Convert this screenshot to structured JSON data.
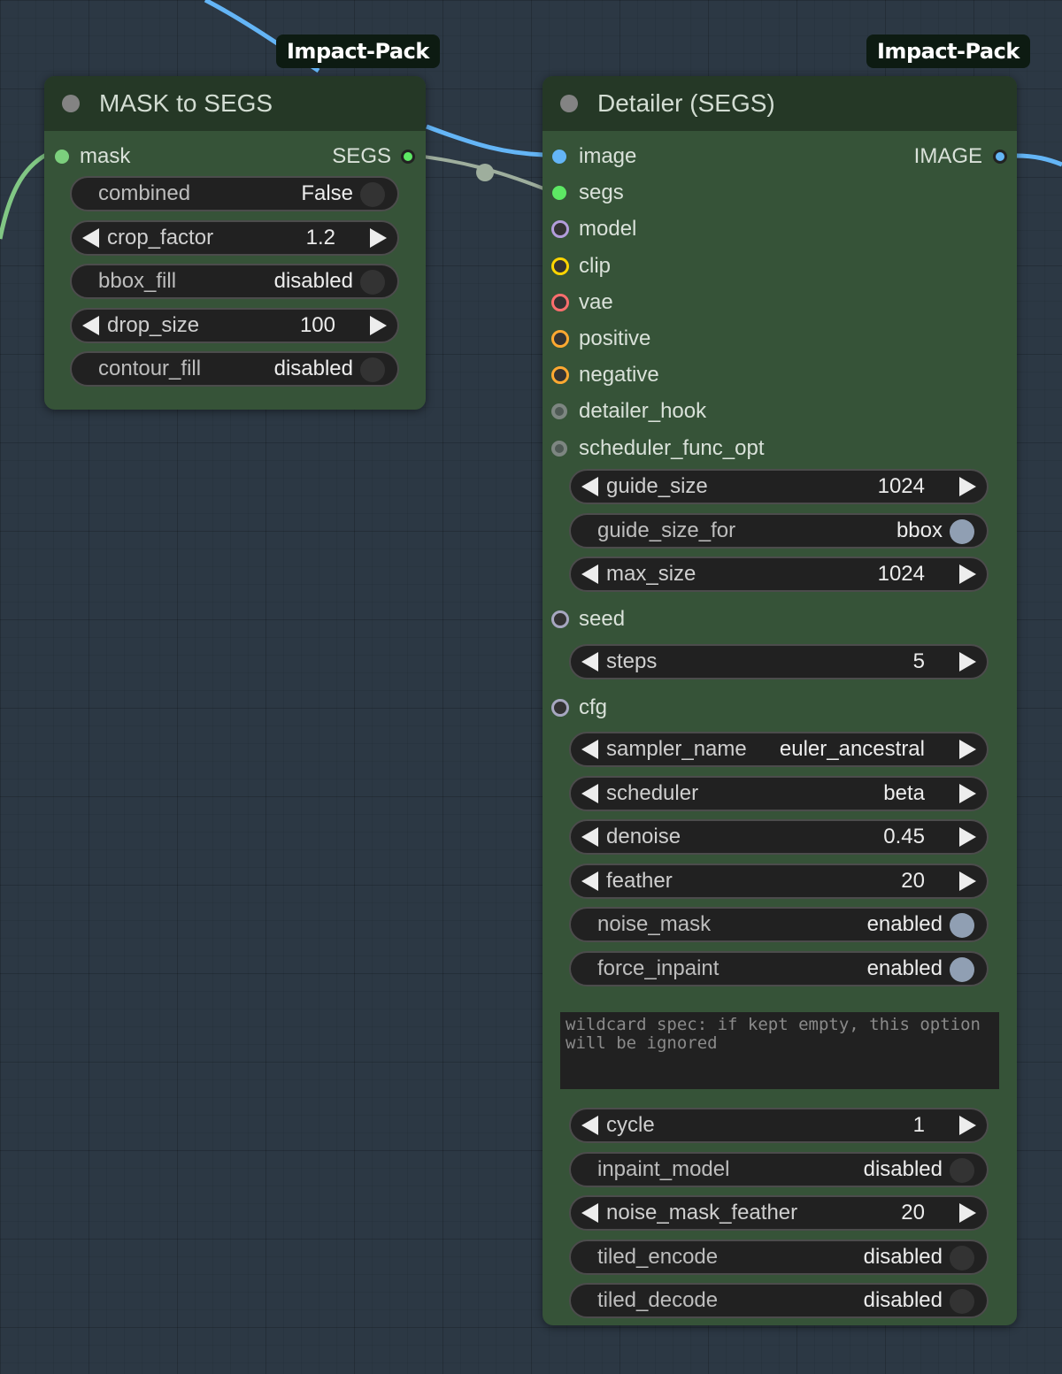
{
  "colors": {
    "canvas": "#2c3844",
    "node_body": "#365338",
    "node_header": "#253826",
    "widget_bg": "#212121",
    "link_image": "#64b5f6",
    "link_mask": "#81c784",
    "link_segs": "#9eae9d"
  },
  "mask_to_segs": {
    "badge": "Impact-Pack",
    "title": "MASK to SEGS",
    "input": {
      "label": "mask",
      "color": "#7ccf7d"
    },
    "output": {
      "label": "SEGS",
      "color": "#5de864"
    },
    "widgets": [
      {
        "type": "toggle",
        "name": "combined",
        "value": "False",
        "on": false
      },
      {
        "type": "number",
        "name": "crop_factor",
        "value": "1.2"
      },
      {
        "type": "toggle",
        "name": "bbox_fill",
        "value": "disabled",
        "on": false
      },
      {
        "type": "number",
        "name": "drop_size",
        "value": "100"
      },
      {
        "type": "toggle",
        "name": "contour_fill",
        "value": "disabled",
        "on": false
      }
    ]
  },
  "detailer": {
    "badge": "Impact-Pack",
    "title": "Detailer (SEGS)",
    "output": {
      "label": "IMAGE",
      "color": "#64b5f6"
    },
    "inputs": [
      {
        "label": "image",
        "color": "#64b5f6",
        "style": "filled"
      },
      {
        "label": "segs",
        "color": "#5de864",
        "style": "filled"
      },
      {
        "label": "model",
        "color": "#b39ddb",
        "style": "ring"
      },
      {
        "label": "clip",
        "color": "#ffd500",
        "style": "ring"
      },
      {
        "label": "vae",
        "color": "#ff6e6e",
        "style": "ring"
      },
      {
        "label": "positive",
        "color": "#ffa931",
        "style": "ring"
      },
      {
        "label": "negative",
        "color": "#ffa931",
        "style": "ring"
      },
      {
        "label": "detailer_hook",
        "color": "#7d8681",
        "style": "optional"
      },
      {
        "label": "scheduler_func_opt",
        "color": "#7d8681",
        "style": "optional"
      }
    ],
    "widgets_a": [
      {
        "type": "number",
        "name": "guide_size",
        "value": "1024"
      },
      {
        "type": "toggle",
        "name": "guide_size_for",
        "value": "bbox",
        "on": true
      },
      {
        "type": "number",
        "name": "max_size",
        "value": "1024"
      }
    ],
    "seed_input": {
      "label": "seed",
      "color": "#a7a7c0"
    },
    "widgets_b": [
      {
        "type": "number",
        "name": "steps",
        "value": "5"
      }
    ],
    "cfg_input": {
      "label": "cfg",
      "color": "#a7a7c0"
    },
    "widgets_c": [
      {
        "type": "number",
        "name": "sampler_name",
        "value": "euler_ancestral"
      },
      {
        "type": "number",
        "name": "scheduler",
        "value": "beta"
      },
      {
        "type": "number",
        "name": "denoise",
        "value": "0.45"
      },
      {
        "type": "number",
        "name": "feather",
        "value": "20"
      },
      {
        "type": "toggle",
        "name": "noise_mask",
        "value": "enabled",
        "on": true
      },
      {
        "type": "toggle",
        "name": "force_inpaint",
        "value": "enabled",
        "on": true
      }
    ],
    "wildcard_placeholder": "wildcard spec: if kept empty, this option will be ignored",
    "widgets_d": [
      {
        "type": "number",
        "name": "cycle",
        "value": "1"
      },
      {
        "type": "toggle",
        "name": "inpaint_model",
        "value": "disabled",
        "on": false
      },
      {
        "type": "number",
        "name": "noise_mask_feather",
        "value": "20"
      },
      {
        "type": "toggle",
        "name": "tiled_encode",
        "value": "disabled",
        "on": false
      },
      {
        "type": "toggle",
        "name": "tiled_decode",
        "value": "disabled",
        "on": false
      }
    ]
  }
}
